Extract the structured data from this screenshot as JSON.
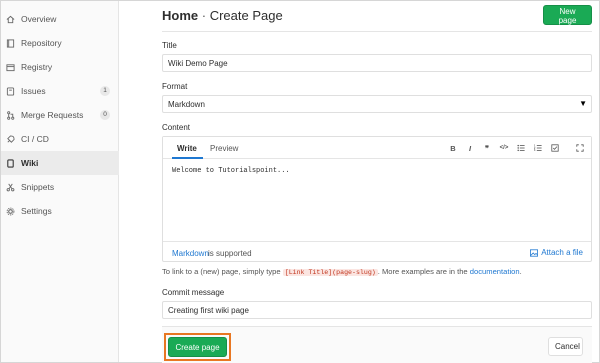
{
  "sidebar": {
    "items": [
      {
        "label": "Overview",
        "icon": "home-icon"
      },
      {
        "label": "Repository",
        "icon": "book-icon"
      },
      {
        "label": "Registry",
        "icon": "container-icon"
      },
      {
        "label": "Issues",
        "icon": "issues-icon",
        "count": "1"
      },
      {
        "label": "Merge Requests",
        "icon": "merge-request-icon",
        "count": "0"
      },
      {
        "label": "CI / CD",
        "icon": "rocket-icon"
      },
      {
        "label": "Wiki",
        "icon": "book-closed-icon",
        "active": true
      },
      {
        "label": "Snippets",
        "icon": "scissors-icon"
      },
      {
        "label": "Settings",
        "icon": "gear-icon"
      }
    ]
  },
  "header": {
    "home": "Home",
    "separator": "·",
    "title": "Create Page",
    "new_page_label": "New page"
  },
  "form": {
    "title_label": "Title",
    "title_value": "Wiki Demo Page",
    "format_label": "Format",
    "format_value": "Markdown",
    "content_label": "Content",
    "tabs": {
      "write": "Write",
      "preview": "Preview"
    },
    "toolbar": {
      "bold": "B",
      "italic": "I",
      "quote": "❞",
      "code": "</>"
    },
    "content_value": "Welcome to Tutorialspoint...",
    "markdown_link": "Markdown",
    "markdown_rest": "is supported",
    "attach_label": "Attach a file",
    "help_prefix": "To link to a (new) page, simply type",
    "help_code": "[Link Title](page-slug)",
    "help_middle": ". More examples are in the",
    "help_link": "documentation",
    "help_suffix": ".",
    "commit_label": "Commit message",
    "commit_value": "Creating first wiki page"
  },
  "actions": {
    "create_label": "Create page",
    "cancel_label": "Cancel"
  },
  "colors": {
    "accent_green": "#1aaa55",
    "link_blue": "#1f78d1",
    "highlight_orange": "#e87722"
  }
}
